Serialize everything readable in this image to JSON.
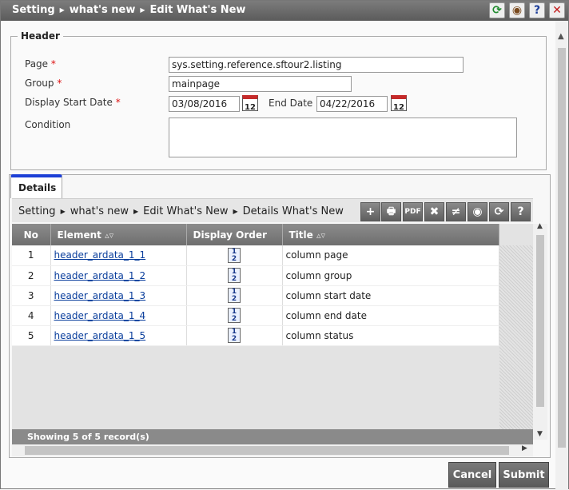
{
  "titlebar": {
    "crumbs": [
      "Setting",
      "what's new",
      "Edit What's New"
    ],
    "buttons": [
      {
        "icon": "refresh-icon",
        "glyph": "⟳",
        "color": "#1f8a2d"
      },
      {
        "icon": "support-icon",
        "glyph": "◉",
        "color": "#7a4a1e"
      },
      {
        "icon": "help-icon",
        "glyph": "?",
        "color": "#1d3f9a"
      },
      {
        "icon": "close-icon",
        "glyph": "✕",
        "color": "#c21b1b"
      }
    ]
  },
  "header": {
    "legend": "Header",
    "page_label": "Page",
    "page_value": "sys.setting.reference.sftour2.listing",
    "group_label": "Group",
    "group_value": "mainpage",
    "start_label": "Display Start Date",
    "start_value": "03/08/2016",
    "end_label": "End Date",
    "end_value": "04/22/2016",
    "condition_label": "Condition",
    "condition_value": "",
    "required_mark": "*",
    "calendar_day": "12"
  },
  "details": {
    "tab_label": "Details",
    "crumbs": [
      "Setting",
      "what's new",
      "Edit What's New",
      "Details What's New"
    ],
    "toolbar": [
      {
        "icon": "add-icon",
        "glyph": "+"
      },
      {
        "icon": "print-icon",
        "glyph": "🖶"
      },
      {
        "icon": "pdf-icon",
        "glyph": "PDF"
      },
      {
        "icon": "excel-icon",
        "glyph": "✖"
      },
      {
        "icon": "sort-icon",
        "glyph": "≠"
      },
      {
        "icon": "support-icon",
        "glyph": "◉"
      },
      {
        "icon": "refresh-icon",
        "glyph": "⟳"
      },
      {
        "icon": "help-icon",
        "glyph": "?"
      }
    ],
    "columns": [
      "No",
      "Element",
      "Display Order",
      "Title"
    ],
    "sort_glyph": "▵▿",
    "rows": [
      {
        "no": "1",
        "element": "header_ardata_1_1",
        "title": "column page"
      },
      {
        "no": "2",
        "element": "header_ardata_1_2",
        "title": "column group"
      },
      {
        "no": "3",
        "element": "header_ardata_1_3",
        "title": "column start date"
      },
      {
        "no": "4",
        "element": "header_ardata_1_4",
        "title": "column end date"
      },
      {
        "no": "5",
        "element": "header_ardata_1_5",
        "title": "column status"
      }
    ],
    "order_icon_text": "1 2",
    "status": "Showing 5 of 5 record(s)"
  },
  "actions": {
    "cancel": "Cancel",
    "submit": "Submit"
  }
}
